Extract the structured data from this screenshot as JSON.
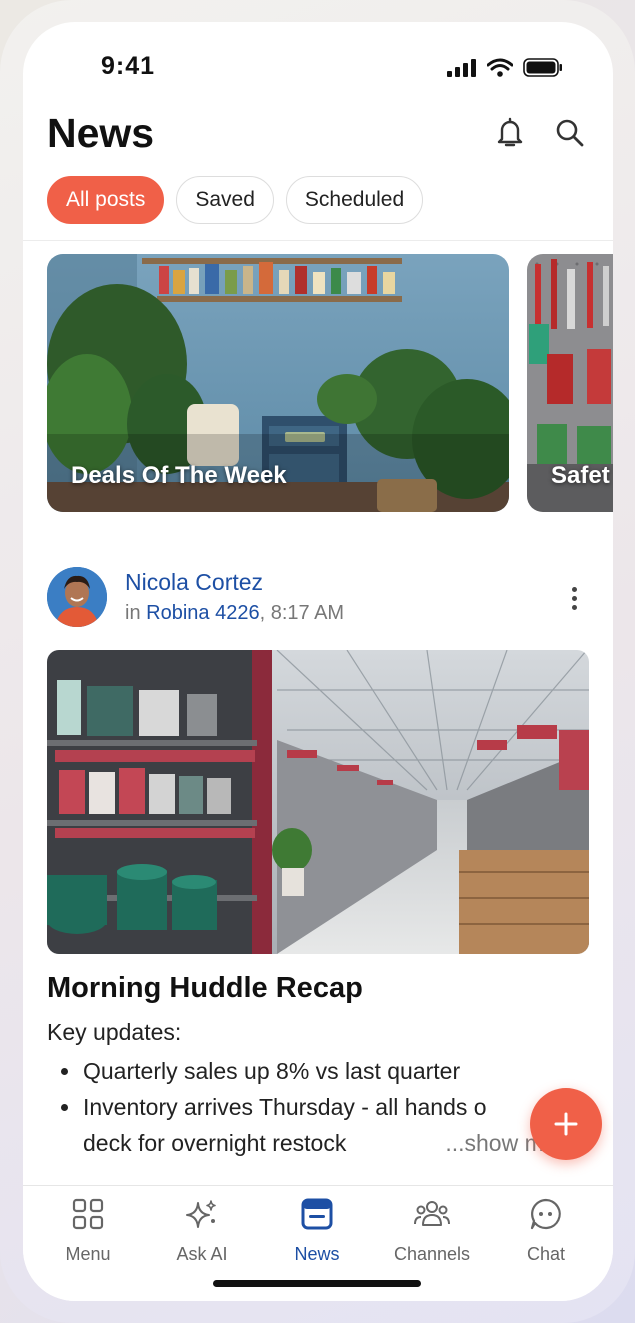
{
  "status_bar": {
    "time": "9:41"
  },
  "header": {
    "title": "News"
  },
  "filters": [
    {
      "label": "All posts",
      "active": true
    },
    {
      "label": "Saved",
      "active": false
    },
    {
      "label": "Scheduled",
      "active": false
    }
  ],
  "featured": [
    {
      "label": "Deals Of The Week"
    },
    {
      "label": "Safet"
    }
  ],
  "post": {
    "author": "Nicola Cortez",
    "in_prefix": "in",
    "location": "Robina 4226",
    "time": ", 8:17 AM",
    "title": "Morning Huddle Recap",
    "intro": "Key updates:",
    "bullets": [
      "Quarterly sales up 8% vs last quarter",
      "Inventory arrives Thursday - all hands o",
      "deck for overnight restock"
    ],
    "show_more": "...show more"
  },
  "tabs": [
    {
      "label": "Menu",
      "icon": "grid-icon"
    },
    {
      "label": "Ask AI",
      "icon": "sparkle-icon"
    },
    {
      "label": "News",
      "icon": "news-icon",
      "active": true
    },
    {
      "label": "Channels",
      "icon": "people-icon"
    },
    {
      "label": "Chat",
      "icon": "chat-icon"
    }
  ],
  "colors": {
    "accent": "#f06048",
    "link": "#1d4fa4"
  }
}
